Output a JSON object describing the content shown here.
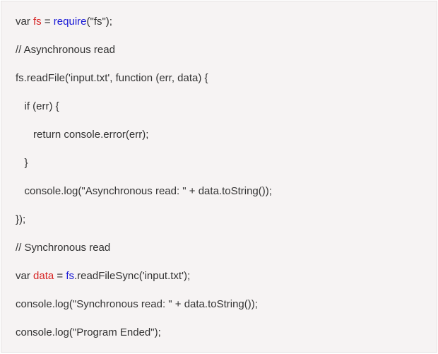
{
  "code": {
    "lines": [
      {
        "indent": 0,
        "segments": [
          {
            "t": "var ",
            "c": ""
          },
          {
            "t": "fs",
            "c": "red"
          },
          {
            "t": " = ",
            "c": ""
          },
          {
            "t": "require",
            "c": "blue"
          },
          {
            "t": "(\"fs\");",
            "c": ""
          }
        ]
      },
      {
        "indent": 0,
        "segments": [
          {
            "t": "// Asynchronous read",
            "c": ""
          }
        ]
      },
      {
        "indent": 0,
        "segments": [
          {
            "t": "fs.readFile('input.txt', function (err, data) {",
            "c": ""
          }
        ]
      },
      {
        "indent": 1,
        "segments": [
          {
            "t": "if (err) {",
            "c": ""
          }
        ]
      },
      {
        "indent": 2,
        "segments": [
          {
            "t": "return console.error(err);",
            "c": ""
          }
        ]
      },
      {
        "indent": 1,
        "segments": [
          {
            "t": "}",
            "c": ""
          }
        ]
      },
      {
        "indent": 1,
        "segments": [
          {
            "t": "console.log(\"Asynchronous read: \" + data.toString());",
            "c": ""
          }
        ]
      },
      {
        "indent": 0,
        "segments": [
          {
            "t": "});",
            "c": ""
          }
        ]
      },
      {
        "indent": 0,
        "segments": [
          {
            "t": "// Synchronous read",
            "c": ""
          }
        ]
      },
      {
        "indent": 0,
        "segments": [
          {
            "t": "var ",
            "c": ""
          },
          {
            "t": "data",
            "c": "red"
          },
          {
            "t": " = ",
            "c": ""
          },
          {
            "t": "fs",
            "c": "blue"
          },
          {
            "t": ".readFileSync('input.txt');",
            "c": ""
          }
        ]
      },
      {
        "indent": 0,
        "segments": [
          {
            "t": "console.log(\"Synchronous read: \" + data.toString());",
            "c": ""
          }
        ]
      },
      {
        "indent": 0,
        "segments": [
          {
            "t": "console.log(\"Program Ended\");",
            "c": ""
          }
        ]
      }
    ]
  }
}
